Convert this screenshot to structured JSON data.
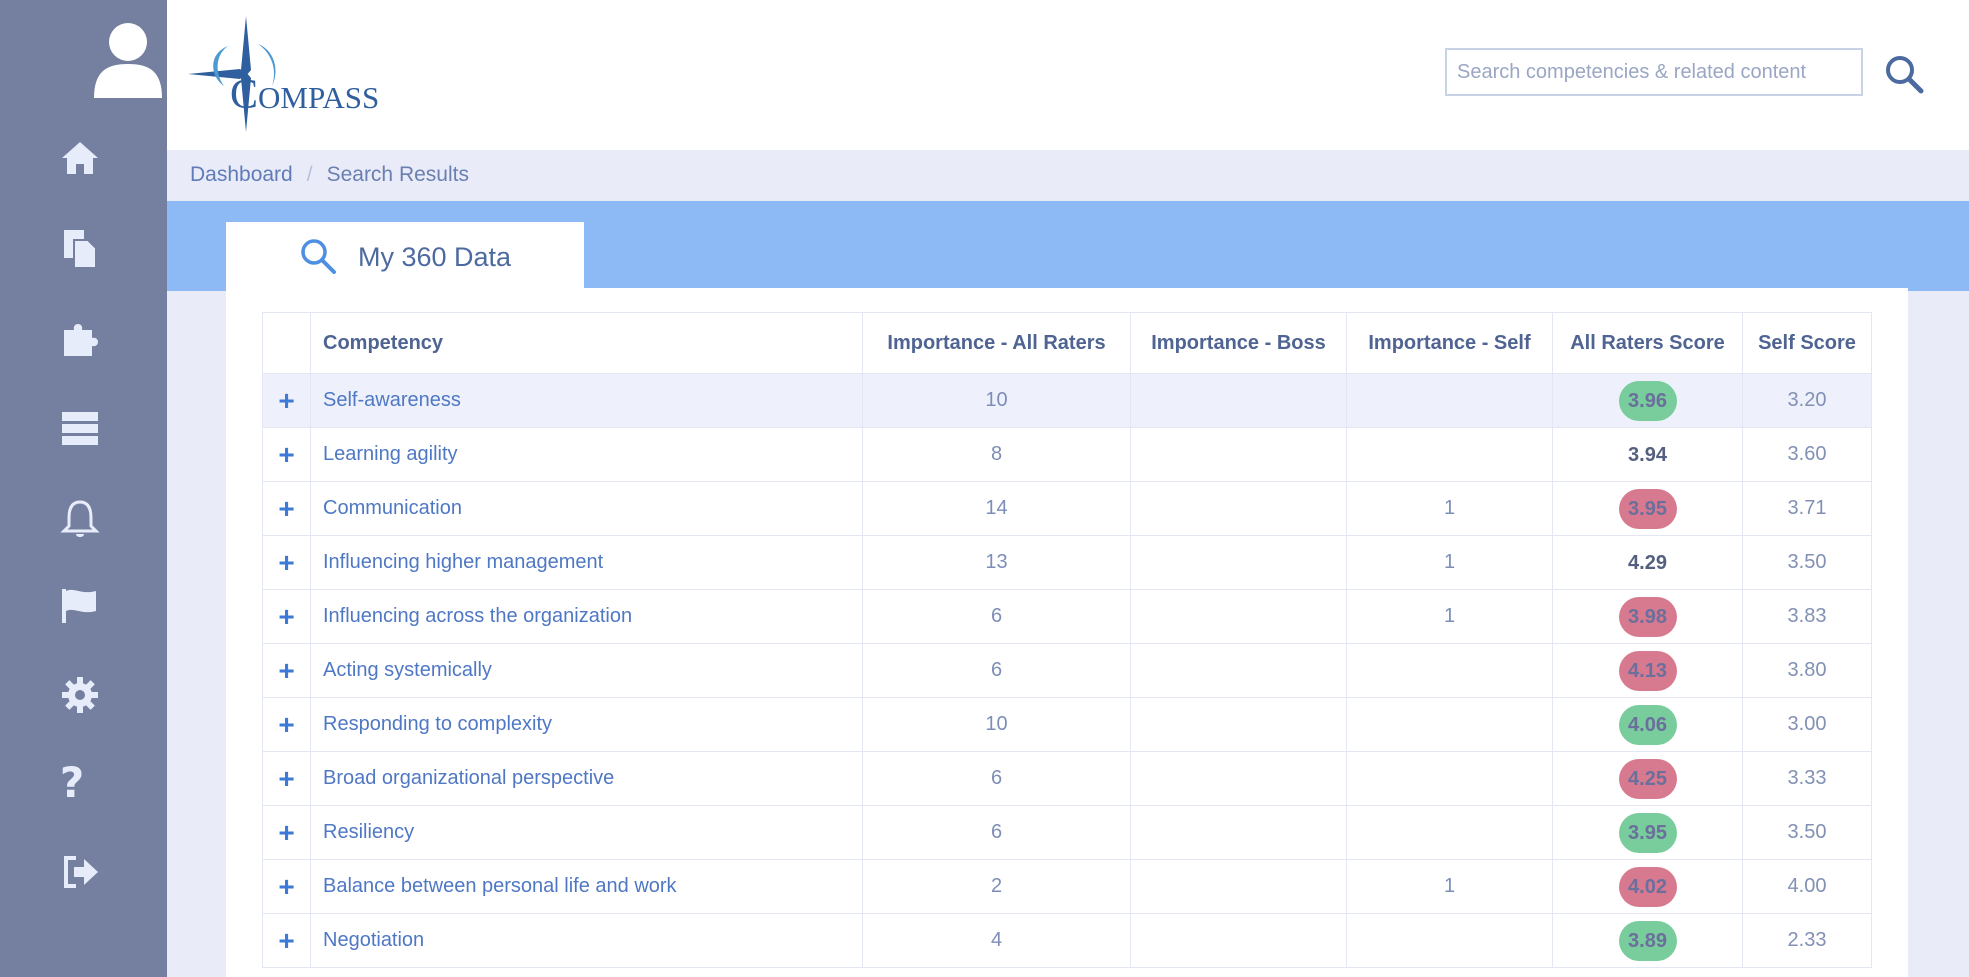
{
  "search": {
    "placeholder": "Search competencies & related content"
  },
  "breadcrumb": {
    "items": [
      "Dashboard",
      "Search Results"
    ],
    "separator": "/"
  },
  "tab": {
    "label": "My 360 Data"
  },
  "logo": {
    "text_first": "C",
    "text_rest": "OMPASS"
  },
  "colors": {
    "sidebar": "#7580a0",
    "band": "#8db9f4",
    "score_high": "#79cc9c",
    "score_low": "#d77a8f"
  },
  "nav_icons": [
    "home-icon",
    "documents-icon",
    "puzzle-icon",
    "database-icon",
    "bell-icon",
    "flag-icon",
    "gear-icon",
    "help-icon",
    "logout-icon"
  ],
  "table": {
    "headers": [
      "Competency",
      "Importance - All Raters",
      "Importance - Boss",
      "Importance - Self",
      "All Raters Score",
      "Self Score"
    ],
    "rows": [
      {
        "competency": "Self-awareness",
        "imp_all": "10",
        "imp_boss": "",
        "imp_self": "",
        "all_score": "3.96",
        "score_color": "green",
        "self_score": "3.20"
      },
      {
        "competency": "Learning agility",
        "imp_all": "8",
        "imp_boss": "",
        "imp_self": "",
        "all_score": "3.94",
        "score_color": "plain",
        "self_score": "3.60"
      },
      {
        "competency": "Communication",
        "imp_all": "14",
        "imp_boss": "",
        "imp_self": "1",
        "all_score": "3.95",
        "score_color": "red",
        "self_score": "3.71"
      },
      {
        "competency": "Influencing higher management",
        "imp_all": "13",
        "imp_boss": "",
        "imp_self": "1",
        "all_score": "4.29",
        "score_color": "plain",
        "self_score": "3.50"
      },
      {
        "competency": "Influencing across the organization",
        "imp_all": "6",
        "imp_boss": "",
        "imp_self": "1",
        "all_score": "3.98",
        "score_color": "red",
        "self_score": "3.83"
      },
      {
        "competency": "Acting systemically",
        "imp_all": "6",
        "imp_boss": "",
        "imp_self": "",
        "all_score": "4.13",
        "score_color": "red",
        "self_score": "3.80"
      },
      {
        "competency": "Responding to complexity",
        "imp_all": "10",
        "imp_boss": "",
        "imp_self": "",
        "all_score": "4.06",
        "score_color": "green",
        "self_score": "3.00"
      },
      {
        "competency": "Broad organizational perspective",
        "imp_all": "6",
        "imp_boss": "",
        "imp_self": "",
        "all_score": "4.25",
        "score_color": "red",
        "self_score": "3.33"
      },
      {
        "competency": "Resiliency",
        "imp_all": "6",
        "imp_boss": "",
        "imp_self": "",
        "all_score": "3.95",
        "score_color": "green",
        "self_score": "3.50"
      },
      {
        "competency": "Balance between personal life and work",
        "imp_all": "2",
        "imp_boss": "",
        "imp_self": "1",
        "all_score": "4.02",
        "score_color": "red",
        "self_score": "4.00"
      },
      {
        "competency": "Negotiation",
        "imp_all": "4",
        "imp_boss": "",
        "imp_self": "",
        "all_score": "3.89",
        "score_color": "green",
        "self_score": "2.33"
      }
    ]
  }
}
